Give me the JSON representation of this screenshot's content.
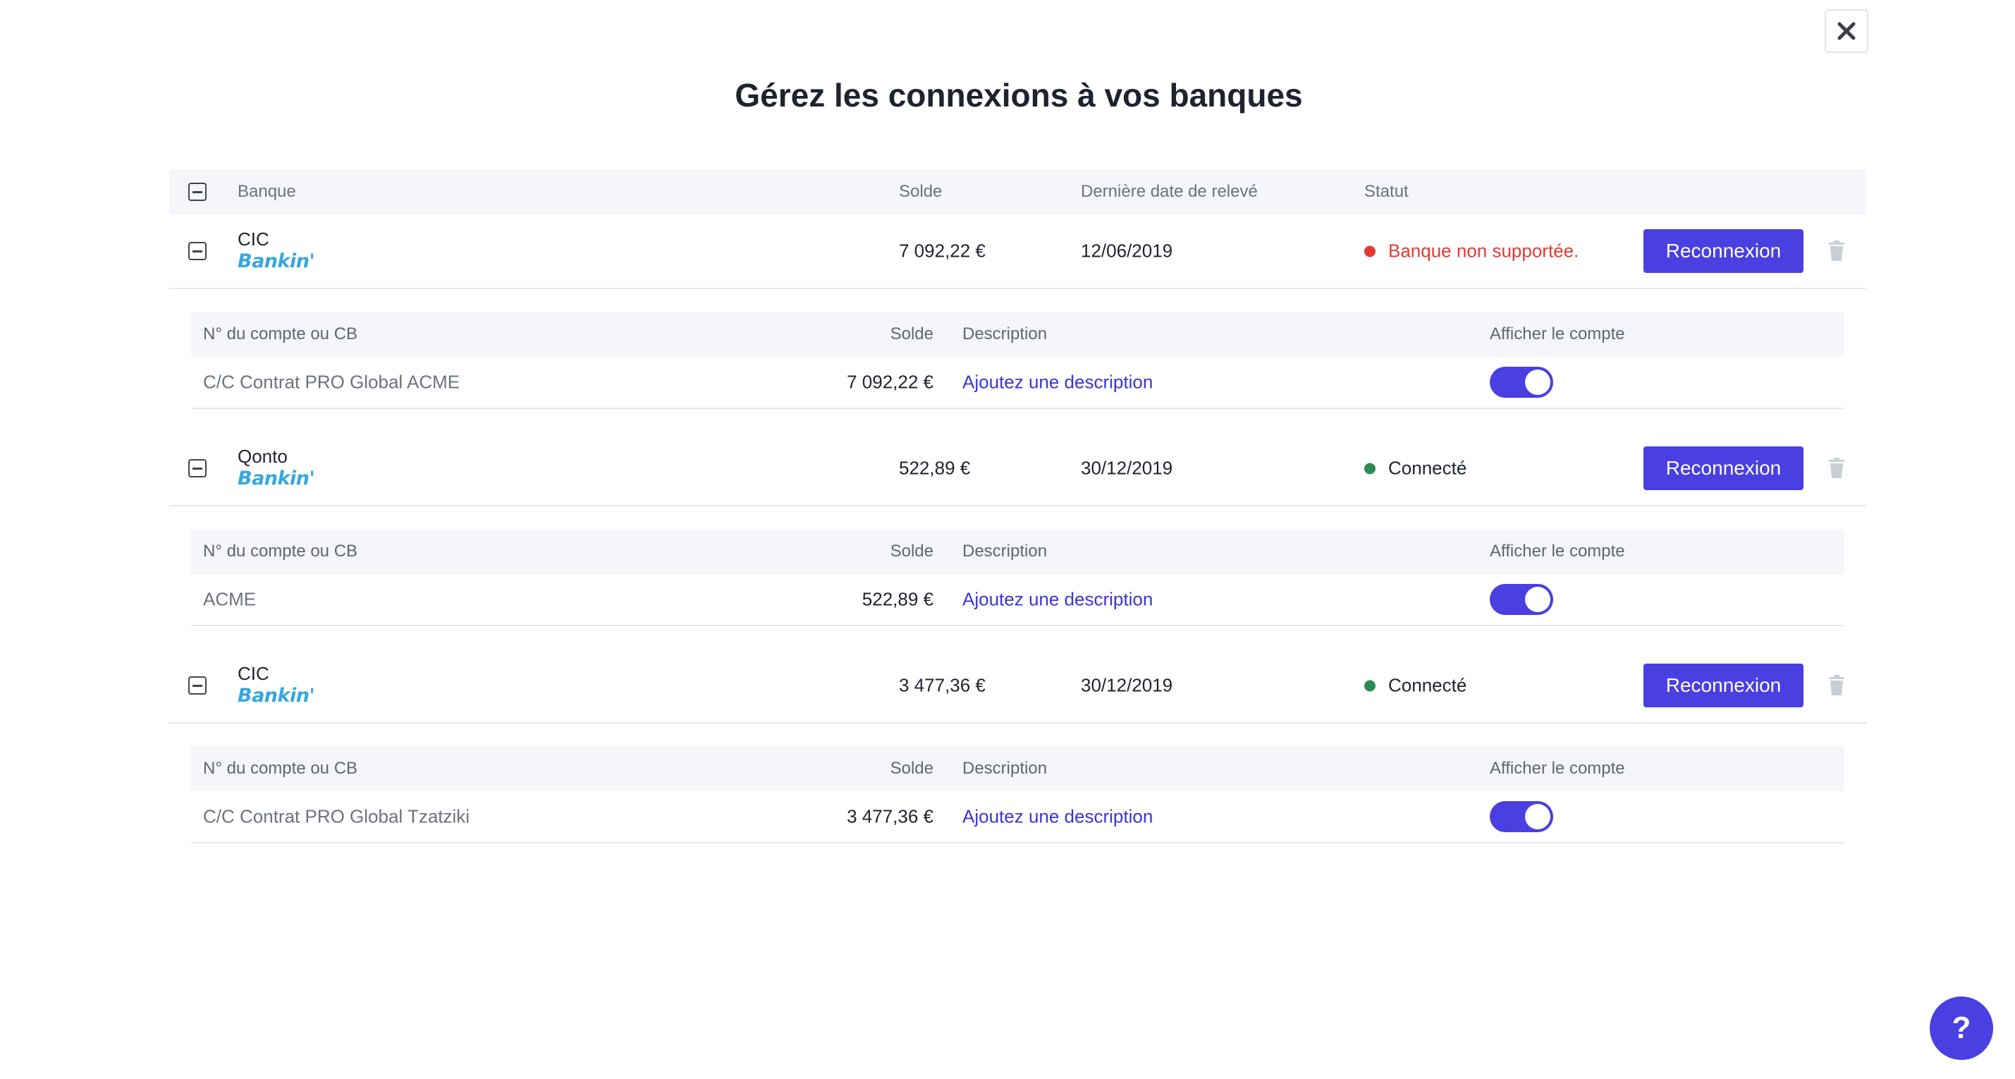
{
  "title": "Gérez les connexions à vos banques",
  "colors": {
    "accent": "#4a3fe0",
    "error": "#e53935",
    "success": "#2e8b57"
  },
  "bank_header": {
    "bank": "Banque",
    "balance": "Solde",
    "last_date": "Dernière date de relevé",
    "status": "Statut"
  },
  "sub_header": {
    "account": "N° du compte ou CB",
    "balance": "Solde",
    "description": "Description",
    "show": "Afficher le compte"
  },
  "banks": [
    {
      "name": "CIC",
      "provider": "Bankin'",
      "balance": "7 092,22 €",
      "date": "12/06/2019",
      "status": "Banque non supportée.",
      "status_type": "error",
      "button": "Reconnexion",
      "account": {
        "name": "C/C Contrat PRO Global ACME",
        "balance": "7 092,22 €",
        "description_link": "Ajoutez une description",
        "visible": true
      }
    },
    {
      "name": "Qonto",
      "provider": "Bankin'",
      "balance": "522,89 €",
      "date": "30/12/2019",
      "status": "Connecté",
      "status_type": "success",
      "button": "Reconnexion",
      "account": {
        "name": "ACME",
        "balance": "522,89 €",
        "description_link": "Ajoutez une description",
        "visible": true
      }
    },
    {
      "name": "CIC",
      "provider": "Bankin'",
      "balance": "3 477,36 €",
      "date": "30/12/2019",
      "status": "Connecté",
      "status_type": "success",
      "button": "Reconnexion",
      "account": {
        "name": "C/C Contrat PRO Global Tzatziki",
        "balance": "3 477,36 €",
        "description_link": "Ajoutez une description",
        "visible": true
      }
    }
  ],
  "help_label": "?"
}
